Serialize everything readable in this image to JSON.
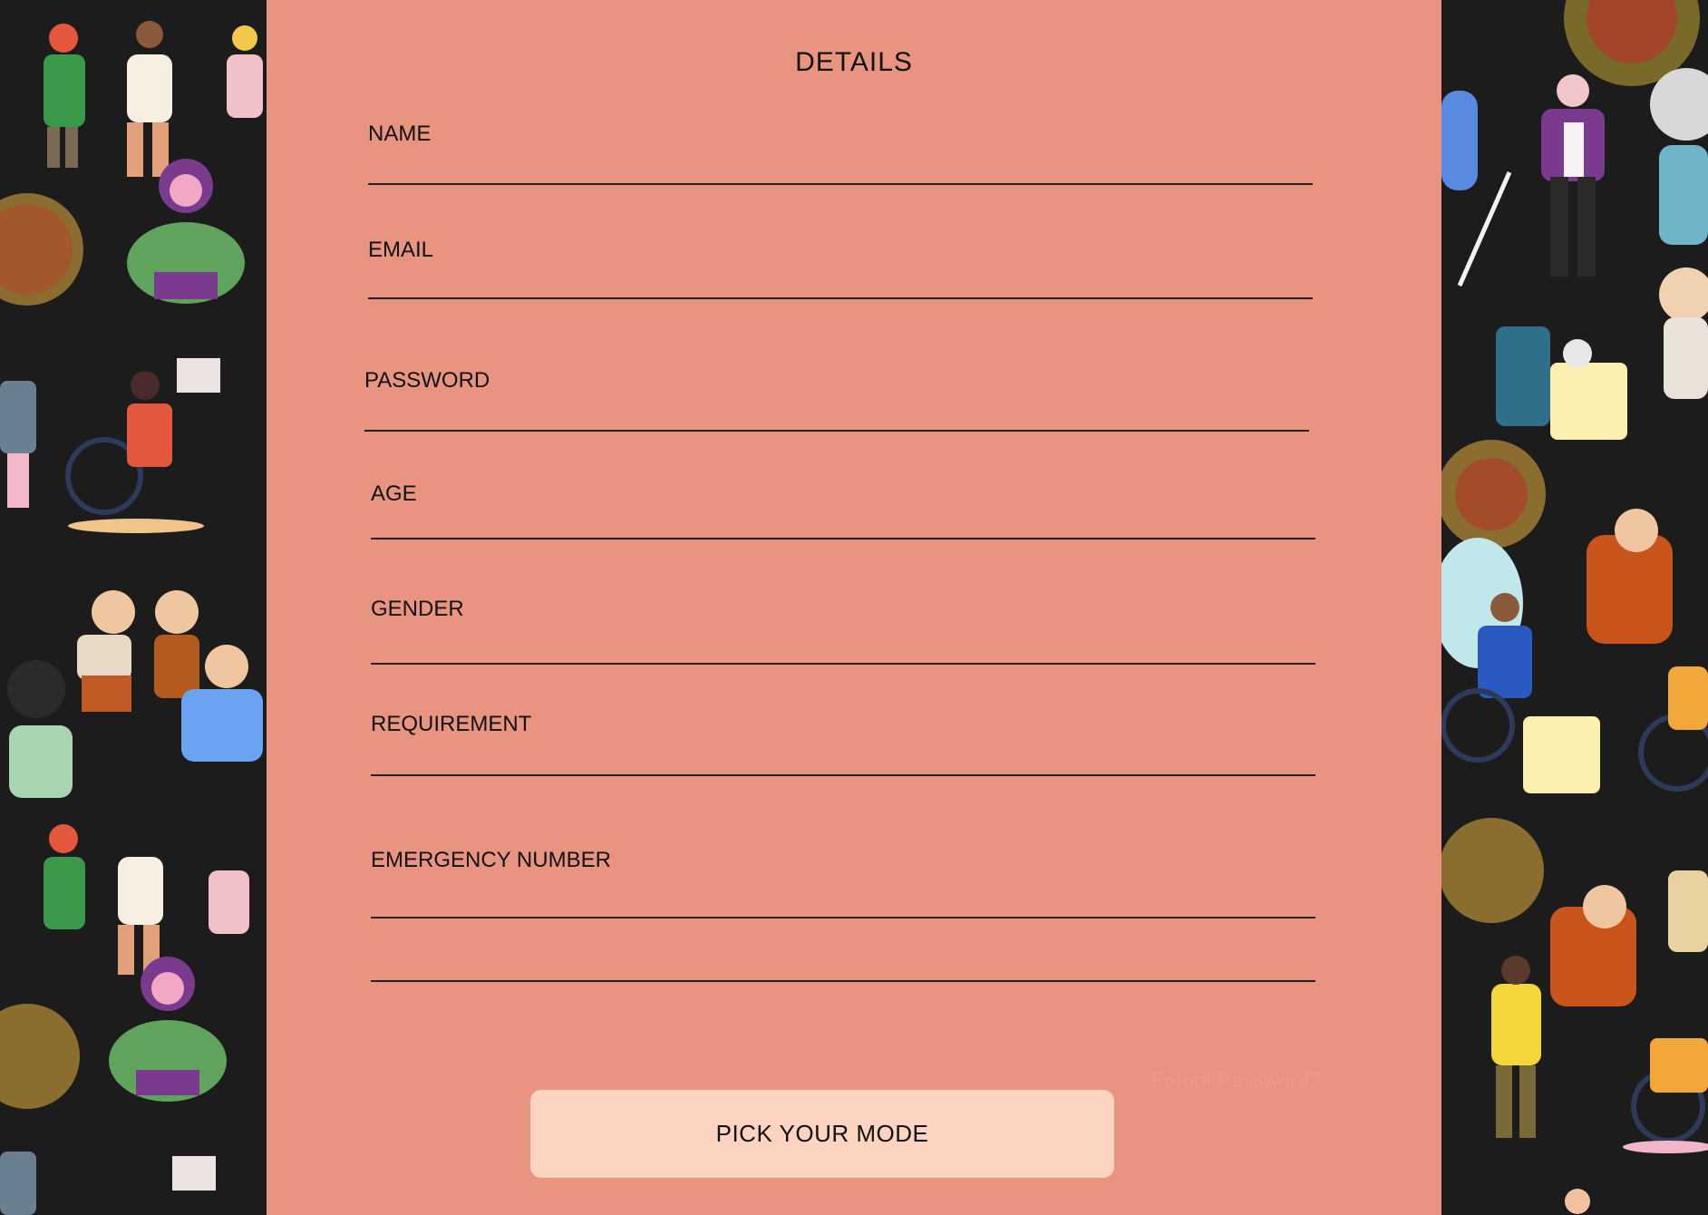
{
  "form": {
    "title": "DETAILS",
    "fields": [
      {
        "label": "NAME",
        "value": ""
      },
      {
        "label": "EMAIL",
        "value": ""
      },
      {
        "label": "PASSWORD",
        "value": ""
      },
      {
        "label": "AGE",
        "value": ""
      },
      {
        "label": "GENDER",
        "value": ""
      },
      {
        "label": "REQUIREMENT",
        "value": ""
      },
      {
        "label": "EMERGENCY NUMBER",
        "value": ""
      }
    ],
    "forgot_link": "Forgot Password?",
    "submit_label": "PICK YOUR MODE"
  },
  "colors": {
    "panel_bg": "#e99481",
    "button_bg": "#fdd3c2",
    "side_bg": "#1c1c1c",
    "forgot_link": "#ee9a87"
  },
  "decor": {
    "left_image": "people-illustration-collage",
    "right_image": "people-illustration-collage"
  }
}
